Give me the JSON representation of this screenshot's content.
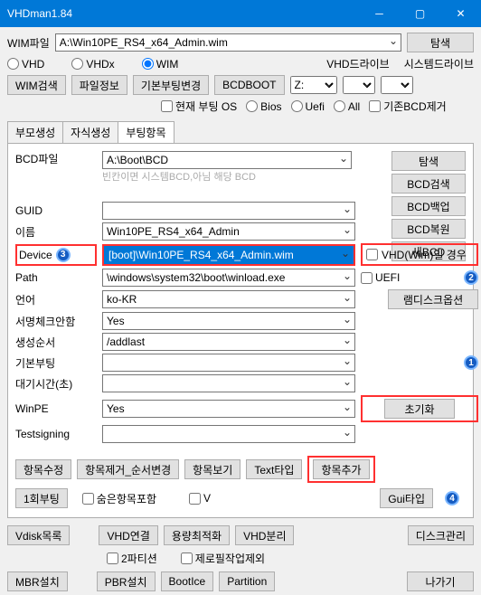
{
  "window": {
    "title": "VHDman1.84"
  },
  "top": {
    "wimfile_label": "WIM파일",
    "wimfile_value": "A:\\Win10PE_RS4_x64_Admin.wim",
    "browse": "탐색",
    "radios": {
      "vhd": "VHD",
      "vhdx": "VHDx",
      "wim": "WIM"
    },
    "vhd_drive_label": "VHD드라이브",
    "sys_drive_label": "시스템드라이브",
    "buttons": {
      "wimsearch": "WIM검색",
      "fileinfo": "파일정보",
      "bootchange": "기본부팅변경",
      "bcdboot": "BCDBOOT"
    },
    "drive_z": "Z:",
    "cur_boot_os": "현재 부팅 OS",
    "bios": "Bios",
    "uefi": "Uefi",
    "all": "All",
    "existing_bcd_del": "기존BCD제거"
  },
  "tabs": {
    "t1": "부모생성",
    "t2": "자식생성",
    "t3": "부팅항목"
  },
  "bcd": {
    "label": "BCD파일",
    "value": "A:\\Boot\\BCD",
    "placeholder": "빈칸이면 시스템BCD,아님 해당 BCD",
    "btns": {
      "browse": "탐색",
      "search": "BCD검색",
      "backup": "BCD백업",
      "restore": "BCD복원",
      "new": "새BCD"
    }
  },
  "fields": {
    "guid": "GUID",
    "name": "이름",
    "device": "Device",
    "path": "Path",
    "lang": "언어",
    "sigcheck": "서명체크안함",
    "order": "생성순서",
    "defboot": "기본부팅",
    "timeout": "대기시간(초)",
    "winpe": "WinPE",
    "testsigning": "Testsigning",
    "name_val": "Win10PE_RS4_x64_Admin",
    "device_val": "[boot]\\Win10PE_RS4_x64_Admin.wim",
    "path_val": "\\windows\\system32\\boot\\winload.exe",
    "lang_val": "ko-KR",
    "sigcheck_val": "Yes",
    "order_val": "/addlast",
    "winpe_val": "Yes"
  },
  "right": {
    "vhdwim": "VHD(Wim)일 경우",
    "uefi": "UEFI",
    "ramdisk": "램디스크옵션",
    "reset": "초기화"
  },
  "mid": {
    "edit": "항목수정",
    "remove_order": "항목제거_순서변경",
    "view": "항목보기",
    "texttype": "Text타입",
    "add": "항목추가",
    "oneboot": "1회부팅",
    "hidden": "숨은항목포함",
    "v": "V",
    "guitype": "Gui타입"
  },
  "bottom": {
    "vdisklist": "Vdisk목록",
    "vhdconnect": "VHD연결",
    "capacity": "용량최적화",
    "vhdsplit": "VHD분리",
    "diskmgmt": "디스크관리",
    "part2": "2파티션",
    "zerofill": "제로필작업제외",
    "mbr": "MBR설치",
    "pbr": "PBR설치",
    "bootice": "BootIce",
    "partition": "Partition",
    "exit": "나가기"
  }
}
